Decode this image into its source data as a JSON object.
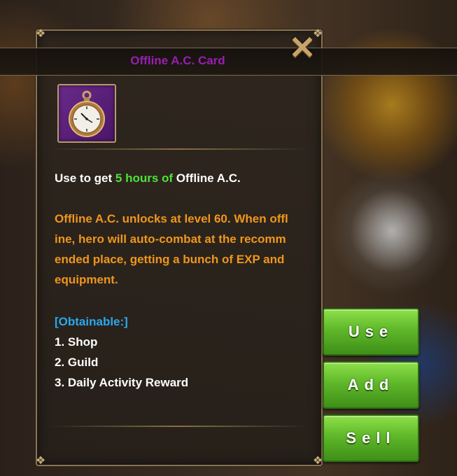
{
  "dialog": {
    "title": "Offline A.C. Card",
    "close_symbol": "✕",
    "item_icon": "pocket-watch-icon",
    "usage": {
      "prefix": "Use to get ",
      "highlight": "5 hours of",
      "suffix": " Offline A.C."
    },
    "description_lines": [
      "Offline A.C. unlocks at level 60. When offl",
      "ine, hero will auto-combat at the recomm",
      "ended place, getting a bunch of EXP and",
      "equipment."
    ],
    "obtainable_header": "[Obtainable:]",
    "sources": [
      "1. Shop",
      "2. Guild",
      "3. Daily Activity Reward"
    ]
  },
  "buttons": {
    "use": "Use",
    "add": "Add",
    "sell": "Sell"
  },
  "colors": {
    "title": "#9a1fb0",
    "highlight": "#4ee33a",
    "description": "#f0961c",
    "obtainable": "#2aa8ee",
    "button_green": "#5fb82a"
  }
}
